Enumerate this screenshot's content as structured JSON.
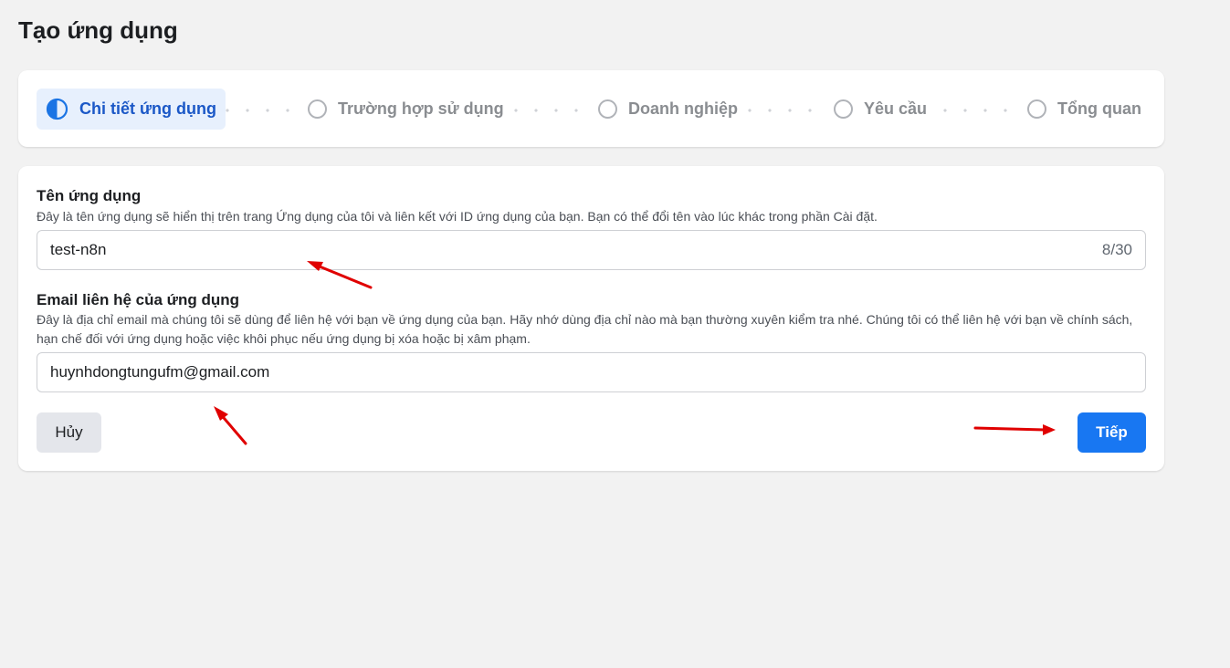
{
  "page": {
    "title": "Tạo ứng dụng"
  },
  "stepper": {
    "steps": [
      {
        "label": "Chi tiết ứng dụng",
        "state": "active"
      },
      {
        "label": "Trường hợp sử dụng",
        "state": "inactive"
      },
      {
        "label": "Doanh nghiệp",
        "state": "inactive"
      },
      {
        "label": "Yêu cầu",
        "state": "inactive"
      },
      {
        "label": "Tổng quan",
        "state": "inactive"
      }
    ]
  },
  "form": {
    "app_name": {
      "label": "Tên ứng dụng",
      "help": "Đây là tên ứng dụng sẽ hiển thị trên trang Ứng dụng của tôi và liên kết với ID ứng dụng của bạn. Bạn có thể đổi tên vào lúc khác trong phần Cài đặt.",
      "value": "test-n8n",
      "counter": "8/30"
    },
    "contact_email": {
      "label": "Email liên hệ của ứng dụng",
      "help": "Đây là địa chỉ email mà chúng tôi sẽ dùng để liên hệ với bạn về ứng dụng của bạn. Hãy nhớ dùng địa chỉ nào mà bạn thường xuyên kiểm tra nhé. Chúng tôi có thể liên hệ với bạn về chính sách, hạn chế đối với ứng dụng hoặc việc khôi phục nếu ứng dụng bị xóa hoặc bị xâm phạm.",
      "value": "huynhdongtungufm@gmail.com"
    },
    "buttons": {
      "cancel": "Hủy",
      "next": "Tiếp"
    }
  },
  "colors": {
    "accent": "#1877f2",
    "active_step_bg": "#e7f0fd",
    "annotation_arrow": "#e00000"
  }
}
